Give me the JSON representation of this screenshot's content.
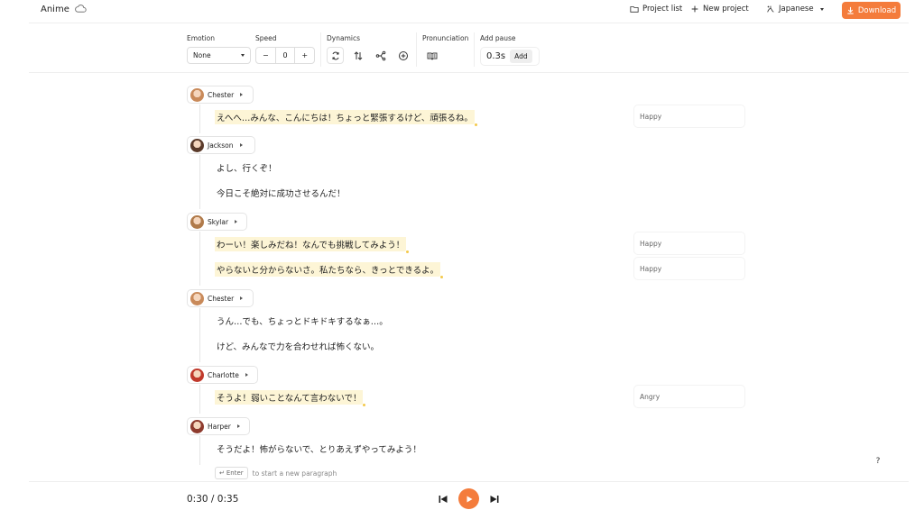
{
  "app": {
    "title": "Anime"
  },
  "header": {
    "project_list": "Project list",
    "new_project": "New project",
    "language": "Japanese",
    "download": "Download"
  },
  "toolbar": {
    "emotion_label": "Emotion",
    "emotion_value": "None",
    "speed_label": "Speed",
    "speed_minus": "−",
    "speed_value": "0",
    "speed_plus": "+",
    "dynamics_label": "Dynamics",
    "pronunciation_label": "Pronunciation",
    "add_pause_label": "Add pause",
    "pause_value": "0.3s",
    "pause_add": "Add"
  },
  "script": [
    {
      "speaker": "Chester",
      "avatar_color": "#c98a5a",
      "lines": [
        {
          "text": "えへへ…みんな、こんにちは！ちょっと緊張するけど、頑張るね。",
          "highlight": true,
          "emotion": "Happy"
        }
      ]
    },
    {
      "speaker": "Jackson",
      "avatar_color": "#5a3a2a",
      "lines": [
        {
          "text": "よし、行くぞ！",
          "highlight": false,
          "emotion": ""
        },
        {
          "text": "今日こそ絶対に成功させるんだ！",
          "highlight": false,
          "emotion": ""
        }
      ]
    },
    {
      "speaker": "Skylar",
      "avatar_color": "#b07a4a",
      "lines": [
        {
          "text": "わーい！楽しみだね！なんでも挑戦してみよう！",
          "highlight": true,
          "emotion": "Happy"
        },
        {
          "text": "やらないと分からないさ。私たちなら、きっとできるよ。",
          "highlight": true,
          "emotion": "Happy"
        }
      ]
    },
    {
      "speaker": "Chester",
      "avatar_color": "#c98a5a",
      "lines": [
        {
          "text": "うん…でも、ちょっとドキドキするなぁ…。",
          "highlight": false,
          "emotion": ""
        },
        {
          "text": "けど、みんなで力を合わせれば怖くない。",
          "highlight": false,
          "emotion": ""
        }
      ]
    },
    {
      "speaker": "Charlotte",
      "avatar_color": "#c0392b",
      "lines": [
        {
          "text": "そうよ！弱いことなんて言わないで！",
          "highlight": true,
          "emotion": "Angry"
        }
      ]
    },
    {
      "speaker": "Harper",
      "avatar_color": "#8e3b2e",
      "lines": [
        {
          "text": "そうだよ！怖がらないで、とりあえずやってみよう！",
          "highlight": false,
          "emotion": ""
        }
      ]
    }
  ],
  "enter_hint": {
    "key": "Enter",
    "text": "to start a new paragraph"
  },
  "help": "?",
  "player": {
    "time": "0:30 / 0:35"
  },
  "colors": {
    "accent": "#f47c3c",
    "highlight": "#fdf5d6"
  }
}
